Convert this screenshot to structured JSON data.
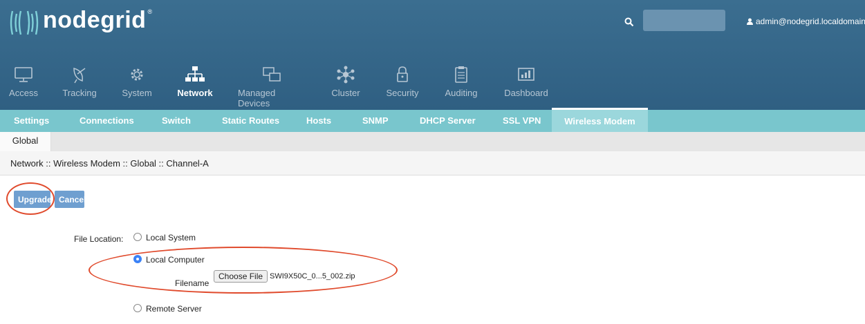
{
  "header": {
    "brand": "nodegrid",
    "brand_mark": "®",
    "search_placeholder": "",
    "user": "admin@nodegrid.localdomain"
  },
  "nav": [
    {
      "label": "Access",
      "icon": "monitor-icon"
    },
    {
      "label": "Tracking",
      "icon": "satellite-dish-icon"
    },
    {
      "label": "System",
      "icon": "gear-icon"
    },
    {
      "label": "Network",
      "icon": "network-tree-icon",
      "active": true
    },
    {
      "label": "Managed Devices",
      "icon": "devices-icon"
    },
    {
      "label": "Cluster",
      "icon": "cluster-icon"
    },
    {
      "label": "Security",
      "icon": "lock-icon"
    },
    {
      "label": "Auditing",
      "icon": "clipboard-icon"
    },
    {
      "label": "Dashboard",
      "icon": "dashboard-icon"
    }
  ],
  "subnav": [
    "Settings",
    "Connections",
    "Switch",
    "Static Routes",
    "Hosts",
    "SNMP",
    "DHCP Server",
    "SSL VPN",
    "Wireless Modem"
  ],
  "subnav_active": "Wireless Modem",
  "tabs": [
    "Global"
  ],
  "breadcrumb": "Network :: Wireless Modem :: Global :: Channel-A",
  "actions": {
    "upgrade": "Upgrade",
    "cancel": "Cancel"
  },
  "form": {
    "file_location_label": "File Location:",
    "options": [
      "Local System",
      "Local Computer",
      "Remote Server"
    ],
    "selected": "Local Computer",
    "filename_label": "Filename",
    "choose_file": "Choose File",
    "file_name": "SWI9X50C_0...5_002.zip"
  },
  "colors": {
    "header": "#2f5f82",
    "subnav": "#79c6cd",
    "button": "#6f9fd0",
    "annotation": "#e04a2c"
  }
}
